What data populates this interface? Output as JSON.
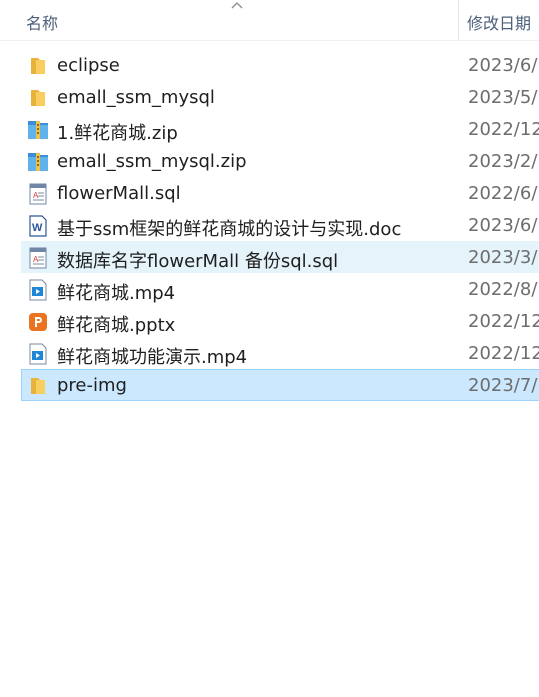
{
  "header": {
    "name_label": "名称",
    "date_label": "修改日期"
  },
  "files": [
    {
      "name": "eclipse",
      "date": "2023/6/",
      "icon": "folder-icon"
    },
    {
      "name": "emall_ssm_mysql",
      "date": "2023/5/",
      "icon": "folder-icon"
    },
    {
      "name": "1.鲜花商城.zip",
      "date": "2022/12",
      "icon": "zip-archive-icon"
    },
    {
      "name": "emall_ssm_mysql.zip",
      "date": "2023/2/",
      "icon": "zip-archive-icon"
    },
    {
      "name": "flowerMall.sql",
      "date": "2022/6/",
      "icon": "sql-file-icon"
    },
    {
      "name": "基于ssm框架的鲜花商城的设计与实现.doc",
      "date": "2023/6/",
      "icon": "word-doc-icon"
    },
    {
      "name": "数据库名字flowerMall 备份sql.sql",
      "date": "2023/3/",
      "icon": "sql-file-icon"
    },
    {
      "name": "鲜花商城.mp4",
      "date": "2022/8/",
      "icon": "video-file-icon"
    },
    {
      "name": "鲜花商城.pptx",
      "date": "2022/12",
      "icon": "powerpoint-icon"
    },
    {
      "name": "鲜花商城功能演示.mp4",
      "date": "2022/12",
      "icon": "video-file-icon"
    },
    {
      "name": "pre-img",
      "date": "2023/7/",
      "icon": "folder-icon"
    }
  ],
  "colors": {
    "hover_row": "#e5f3fb",
    "selected_row": "#cce8ff",
    "selected_border": "#99d1ff",
    "folder": "#f8cf5f",
    "header_text": "#4c607a"
  }
}
